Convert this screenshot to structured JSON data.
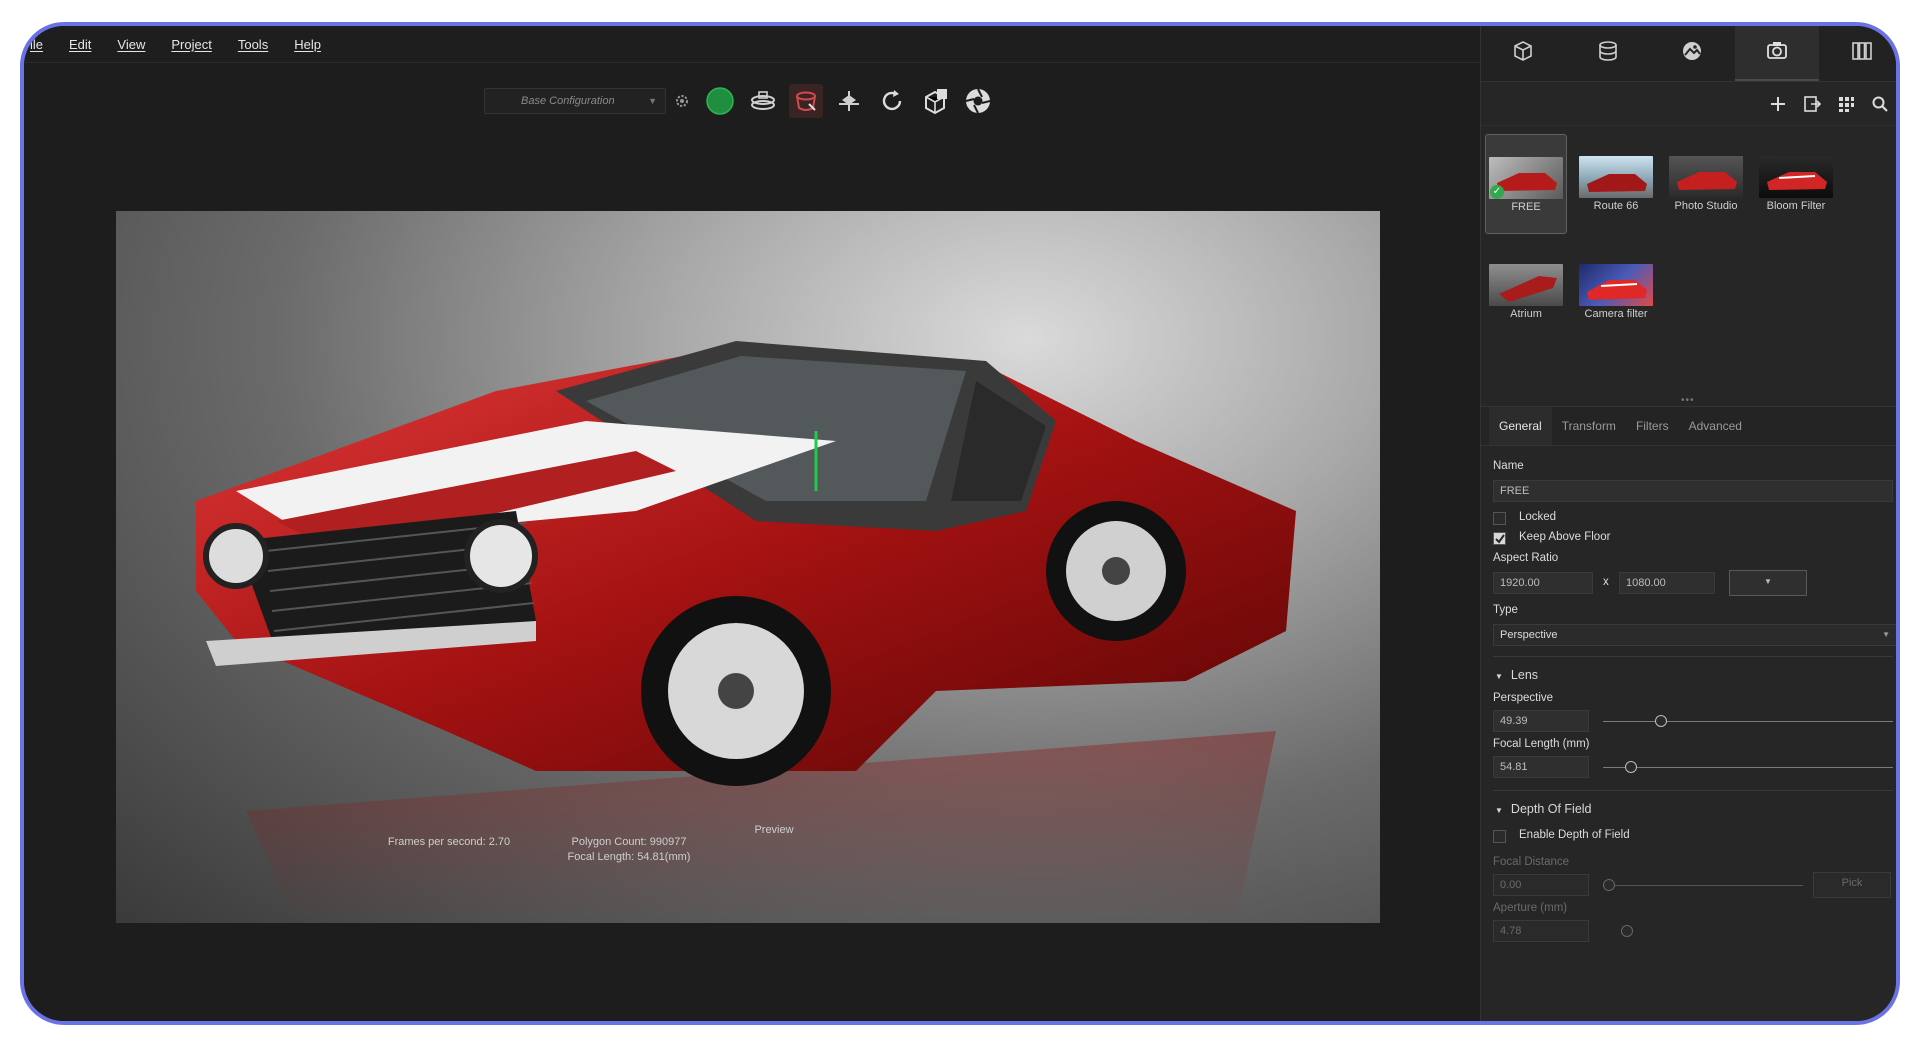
{
  "menu": [
    "ile",
    "Edit",
    "View",
    "Project",
    "Tools",
    "Help"
  ],
  "toolbar": {
    "config_value": "Base Configuration",
    "icons": [
      "settings-gear-icon",
      "green-status-icon",
      "turntable-icon",
      "paint-bucket-icon",
      "pivot-icon",
      "refresh-icon",
      "cube-add-icon",
      "shutter-icon"
    ]
  },
  "viewport": {
    "fps": "Frames per second: 2.70",
    "polygon_count": "Polygon Count: 990977",
    "focal_length": "Focal Length: 54.81(mm)",
    "preview": "Preview"
  },
  "panel": {
    "tabs": [
      "cube-icon",
      "database-icon",
      "environment-icon",
      "camera-icon",
      "columns-icon"
    ],
    "actions": [
      "plus-icon",
      "export-icon",
      "grid-icon",
      "search-icon"
    ],
    "presets": [
      {
        "label": "FREE",
        "selected": true
      },
      {
        "label": "Route 66",
        "selected": false
      },
      {
        "label": "Photo Studio",
        "selected": false
      },
      {
        "label": "Bloom Filter",
        "selected": false
      },
      {
        "label": "Atrium",
        "selected": false
      },
      {
        "label": "Camera filter",
        "selected": false
      }
    ],
    "prop_tabs": [
      "General",
      "Transform",
      "Filters",
      "Advanced"
    ],
    "name_label": "Name",
    "name_value": "FREE",
    "locked_label": "Locked",
    "locked_checked": false,
    "keep_above_floor_label": "Keep Above Floor",
    "keep_above_floor_checked": true,
    "aspect_ratio_label": "Aspect Ratio",
    "aspect_width": "1920.00",
    "aspect_x": "x",
    "aspect_height": "1080.00",
    "type_label": "Type",
    "type_value": "Perspective",
    "lens_section": "Lens",
    "perspective_label": "Perspective",
    "perspective_value": "49.39",
    "focal_length_label": "Focal Length (mm)",
    "focal_length_value": "54.81",
    "dof_section": "Depth Of Field",
    "enable_dof_label": "Enable Depth of Field",
    "enable_dof_checked": false,
    "focal_distance_label": "Focal Distance",
    "focal_distance_value": "0.00",
    "pick_label": "Pick",
    "aperture_label": "Aperture (mm)",
    "aperture_value": "4.78"
  }
}
